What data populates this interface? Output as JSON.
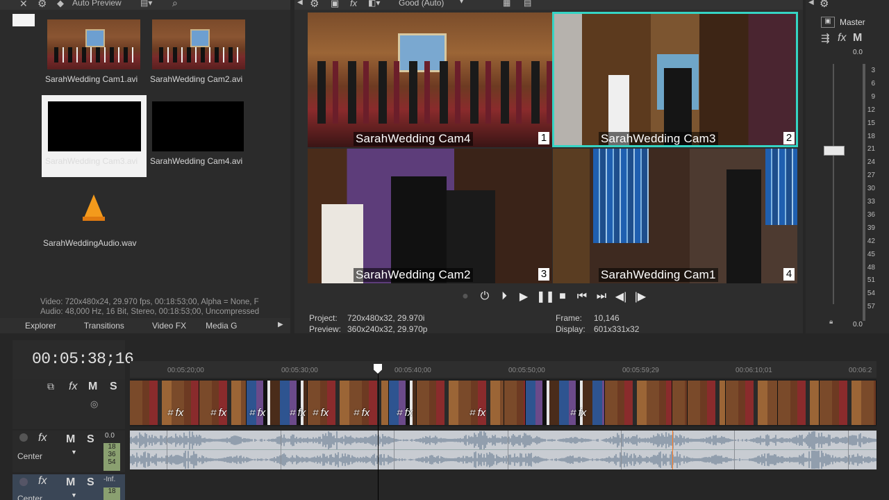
{
  "toolbar_left": {
    "title": "Auto Preview"
  },
  "media": [
    {
      "name": "SarahWedding Cam1.avi"
    },
    {
      "name": "SarahWedding Cam2.avi"
    },
    {
      "name": "SarahWedding Cam3.avi"
    },
    {
      "name": "SarahWedding Cam4.avi"
    },
    {
      "name": "SarahWeddingAudio.wav"
    }
  ],
  "media_info": {
    "video": "Video: 720x480x24, 29.970 fps, 00:18:53;00, Alpha = None, F",
    "audio": "Audio: 48,000 Hz, 16 Bit, Stereo, 00:18:53;00, Uncompressed"
  },
  "left_tabs": [
    "Explorer",
    "Transitions",
    "Video FX",
    "Media G"
  ],
  "preview_toolbar": {
    "quality": "Good (Auto)"
  },
  "preview": {
    "cams": [
      {
        "label": "SarahWedding Cam4",
        "num": "1"
      },
      {
        "label": "SarahWedding Cam3",
        "num": "2"
      },
      {
        "label": "SarahWedding Cam2",
        "num": "3"
      },
      {
        "label": "SarahWedding Cam1",
        "num": "4"
      }
    ],
    "project_label": "Project:",
    "project_value": "720x480x32, 29.970i",
    "preview_label": "Preview:",
    "preview_value": "360x240x32, 29.970p",
    "frame_label": "Frame:",
    "frame_value": "10,146",
    "display_label": "Display:",
    "display_value": "601x331x32"
  },
  "transport": {
    "icons": [
      "loop-icon",
      "play-from-start-icon",
      "play-icon",
      "pause-icon",
      "stop-icon",
      "prev-marker-icon",
      "next-marker-icon",
      "prev-frame-icon",
      "next-frame-icon"
    ]
  },
  "master": {
    "title": "Master",
    "top_value": "0.0",
    "bottom_value": "0.0",
    "scale": [
      "3",
      "6",
      "9",
      "12",
      "15",
      "18",
      "21",
      "24",
      "27",
      "30",
      "33",
      "36",
      "39",
      "42",
      "45",
      "48",
      "51",
      "54",
      "57"
    ]
  },
  "timeline": {
    "timecode": "00:05:38;16",
    "ruler": [
      "00:05:20;00",
      "00:05:30;00",
      "00:05:40;00",
      "00:05:50;00",
      "00:05:59;29",
      "00:06:10;01",
      "00:06:2"
    ],
    "audio_track": {
      "level": "0.0",
      "pan": "Center",
      "meter": [
        "18",
        "36",
        "54"
      ]
    },
    "track3": {
      "level": "-Inf.",
      "pan": "Center",
      "meter": [
        "18"
      ]
    },
    "buttons": {
      "m": "M",
      "s": "S",
      "fx": "fx"
    }
  },
  "colors": {
    "selection": "#35d4c4",
    "playhead_marker": "#ff7a20"
  }
}
